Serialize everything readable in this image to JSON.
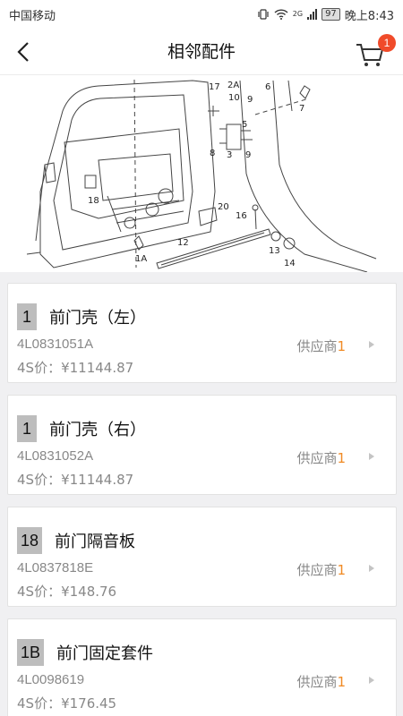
{
  "status_bar": {
    "carrier": "中国移动",
    "network": "2G",
    "battery": "97",
    "time": "晚上8:43"
  },
  "header": {
    "title": "相邻配件",
    "cart_count": "1"
  },
  "diagram": {
    "labels": [
      "17",
      "10",
      "2A",
      "6",
      "7",
      "9",
      "8",
      "3",
      "5",
      "9",
      "18",
      "20",
      "16",
      "1A",
      "12",
      "13",
      "14"
    ]
  },
  "colors": {
    "accent_orange": "#f08a24",
    "badge_red": "#f04b2a",
    "number_tag_gray": "#bdbdbd"
  },
  "parts": [
    {
      "num": "1",
      "name": "前门壳（左）",
      "code": "4L0831051A",
      "price": "4S价：¥11144.87",
      "supplier_label": "供应商",
      "supplier_count": "1"
    },
    {
      "num": "1",
      "name": "前门壳（右）",
      "code": "4L0831052A",
      "price": "4S价：¥11144.87",
      "supplier_label": "供应商",
      "supplier_count": "1"
    },
    {
      "num": "18",
      "name": "前门隔音板",
      "code": "4L0837818E",
      "price": "4S价：¥148.76",
      "supplier_label": "供应商",
      "supplier_count": "1"
    },
    {
      "num": "1B",
      "name": "前门固定套件",
      "code": "4L0098619",
      "price": "4S价：¥176.45",
      "supplier_label": "供应商",
      "supplier_count": "1"
    }
  ]
}
